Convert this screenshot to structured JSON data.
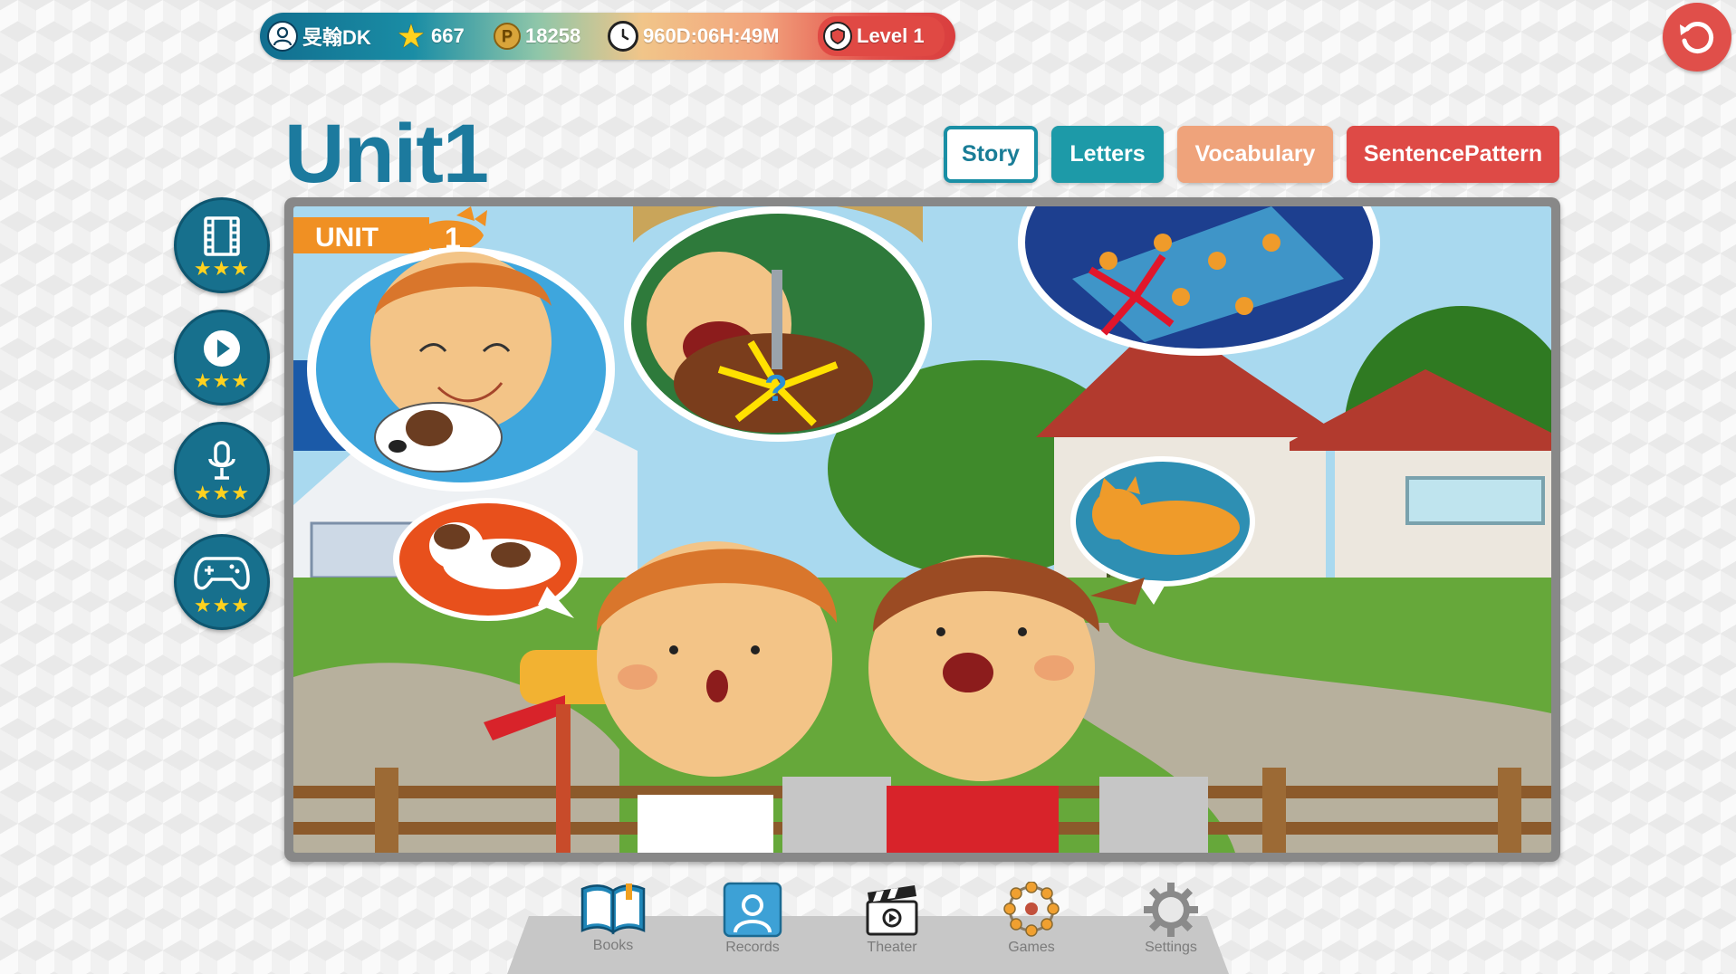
{
  "header": {
    "username": "旻翰DK",
    "stars": "667",
    "points": "18258",
    "timer": "960D:06H:49M",
    "level": "Level 1",
    "icons": {
      "user": "user-icon",
      "stars": "star-icon",
      "points": "coin-icon",
      "timer": "clock-icon",
      "level": "shield-icon",
      "back": "back-arrow-icon"
    }
  },
  "page": {
    "title": "Unit1"
  },
  "tabs": [
    {
      "label": "Story",
      "selected": true,
      "color": "#1a8fa5"
    },
    {
      "label": "Letters",
      "selected": false,
      "color": "#1d9aa8"
    },
    {
      "label": "Vocabulary",
      "selected": false,
      "color": "#efa37b"
    },
    {
      "label": "SentencePattern",
      "selected": false,
      "color": "#de4a46"
    }
  ],
  "activities": [
    {
      "icon": "film-icon",
      "stars": 3
    },
    {
      "icon": "play-icon",
      "stars": 3
    },
    {
      "icon": "microphone-icon",
      "stars": 3
    },
    {
      "icon": "gamepad-icon",
      "stars": 3
    }
  ],
  "illustration": {
    "badge": "UNIT",
    "badge_number": "1",
    "question_mark": "?"
  },
  "bottom_nav": [
    {
      "label": "Books",
      "icon": "book-icon"
    },
    {
      "label": "Records",
      "icon": "profile-icon"
    },
    {
      "label": "Theater",
      "icon": "clapperboard-icon"
    },
    {
      "label": "Games",
      "icon": "ferris-wheel-icon"
    },
    {
      "label": "Settings",
      "icon": "gear-icon"
    }
  ],
  "colors": {
    "primary": "#17708d",
    "title": "#1c7a9e",
    "accent_red": "#e04f4a",
    "accent_orange": "#efa37b"
  }
}
